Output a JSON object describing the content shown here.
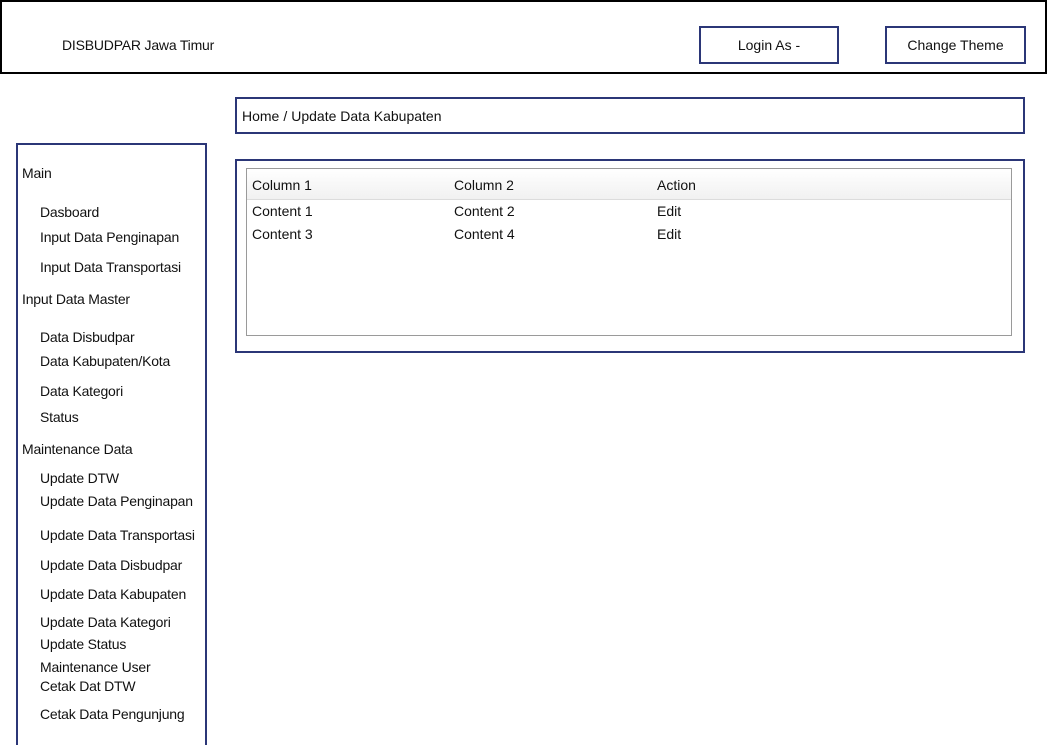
{
  "header": {
    "brand": "DISBUDPAR Jawa Timur",
    "login_label": "Login As -",
    "theme_label": "Change Theme"
  },
  "breadcrumb": {
    "home": "Home",
    "separator": "/",
    "current": "Update Data Kabupaten"
  },
  "sidebar": {
    "sections": [
      {
        "label": "Main",
        "items": [
          "Dasboard",
          "Input Data Penginapan",
          "Input Data Transportasi"
        ]
      },
      {
        "label": "Input Data Master",
        "items": [
          "Data Disbudpar",
          "Data Kabupaten/Kota",
          "Data Kategori",
          "Status"
        ]
      },
      {
        "label": "Maintenance Data",
        "items": [
          "Update DTW",
          "Update Data Penginapan",
          "Update Data Transportasi",
          "Update Data Disbudpar",
          "Update Data Kabupaten",
          "Update Data Kategori",
          "Update Status",
          "Maintenance User",
          "Cetak Dat DTW",
          "Cetak Data Pengunjung"
        ]
      }
    ]
  },
  "table": {
    "columns": [
      "Column 1",
      "Column 2",
      "Action"
    ],
    "rows": [
      [
        "Content 1",
        "Content 2",
        "Edit"
      ],
      [
        "Content 3",
        "Content 4",
        "Edit"
      ]
    ]
  },
  "colors": {
    "border_accent": "#2b3677",
    "header_border": "#000000"
  }
}
